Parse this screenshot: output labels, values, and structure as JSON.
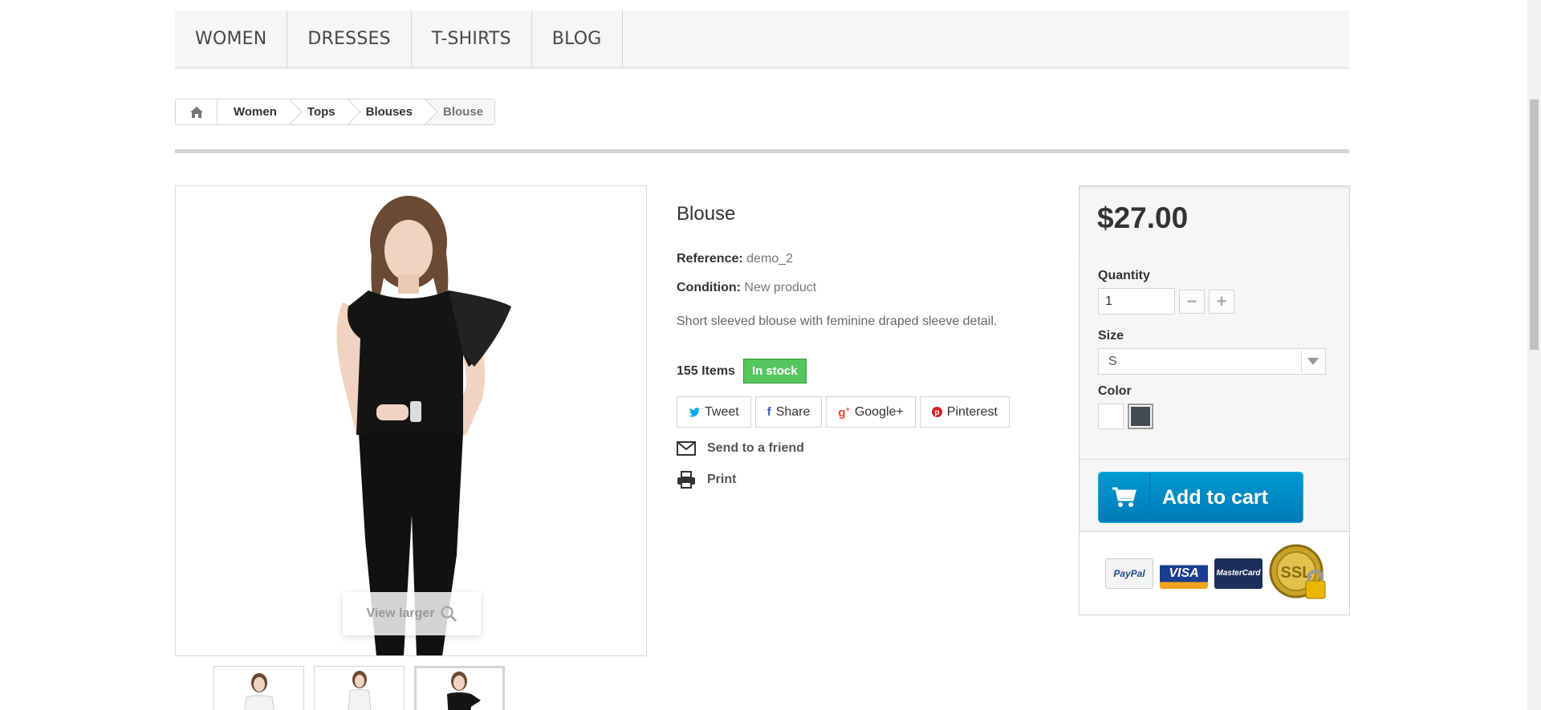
{
  "menu": [
    "WOMEN",
    "DRESSES",
    "T-SHIRTS",
    "BLOG"
  ],
  "breadcrumb": {
    "items": [
      "Women",
      "Tops",
      "Blouses"
    ],
    "current": "Blouse",
    "home_icon": "home-icon"
  },
  "image": {
    "view_larger": "View larger"
  },
  "product": {
    "name": "Blouse",
    "reference_label": "Reference:",
    "reference": "demo_2",
    "condition_label": "Condition:",
    "condition": "New product",
    "description": "Short sleeved blouse with feminine draped sleeve detail.",
    "stock_count": "155 Items",
    "stock_status": "In stock"
  },
  "social": {
    "tweet": "Tweet",
    "share": "Share",
    "google": "Google+",
    "pinterest": "Pinterest"
  },
  "links": {
    "send": "Send to a friend",
    "print": "Print"
  },
  "buy": {
    "price": "$27.00",
    "quantity_label": "Quantity",
    "quantity": "1",
    "size_label": "Size",
    "size": "S",
    "color_label": "Color",
    "colors": [
      "#ffffff",
      "#434a54"
    ],
    "add_to_cart": "Add to cart"
  },
  "payment": {
    "paypal": "PayPal",
    "visa": "VISA",
    "mastercard": "MasterCard",
    "ssl": "SSL"
  },
  "colors": {
    "in_stock": "#55c65e",
    "cart_button": "#009ad0"
  }
}
